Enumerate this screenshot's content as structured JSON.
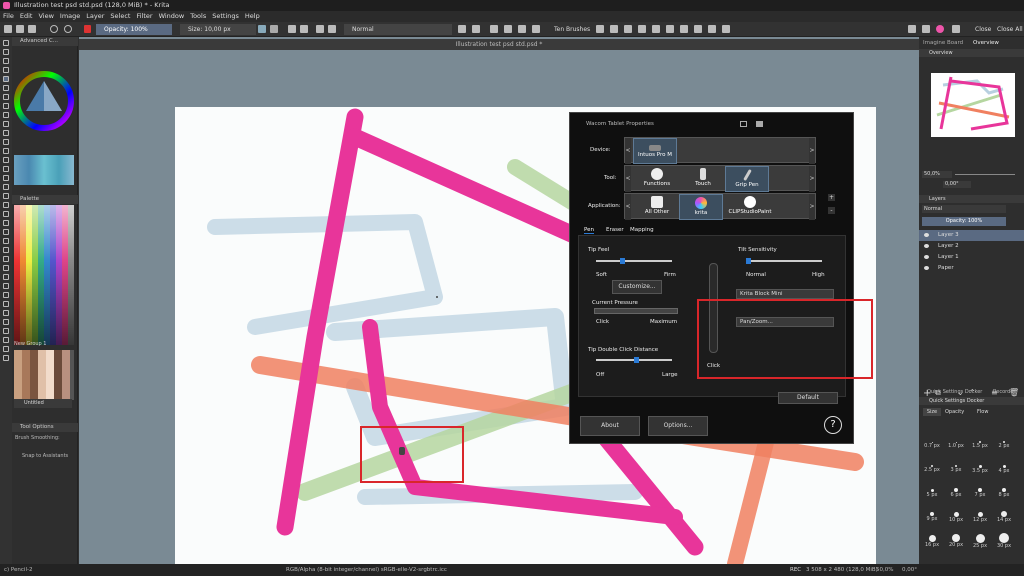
{
  "window": {
    "title": "Illustration test psd std.psd (128,0 MiB)  * - Krita"
  },
  "menu": [
    "File",
    "Edit",
    "View",
    "Image",
    "Layer",
    "Select",
    "Filter",
    "Window",
    "Tools",
    "Settings",
    "Help"
  ],
  "toolbar": {
    "opacity": "Opacity: 100%",
    "size": "Size: 10,00 px",
    "blend_mode": "Normal",
    "brushes_label": "Ten Brushes",
    "close_label": "Close",
    "close_all_label": "Close All"
  },
  "left_dock": {
    "advanced_color": "Advanced C...",
    "palette_title": "Palette",
    "palette_group": "New Group 1",
    "palette_name": "Untitled",
    "tool_options_title": "Tool Options",
    "brush_smoothing": "Brush Smoothing:",
    "snap_assistants": "Snap to Assistants"
  },
  "document": {
    "tab": "Illustration test psd std.psd *"
  },
  "right_dock": {
    "tabs": [
      "Imagine Board",
      "Overview"
    ],
    "overview_title": "Overview",
    "zoom": "50,0%",
    "rotation": "0,00°",
    "layers_title": "Layers",
    "blend": "Normal",
    "opacity": "Opacity:  100%",
    "layers": [
      "Layer 3",
      "Layer 2",
      "Layer 1",
      "Paper"
    ],
    "bottom_tabs": [
      "Quick Settings Docker",
      "Recorder"
    ],
    "qs_title": "Quick Settings Docker",
    "qs_tabs": [
      "Size",
      "Opacity",
      "Flow"
    ],
    "brush_sizes": [
      "0.7 px",
      "1.0 px",
      "1.5 px",
      "2 px",
      "2.5 px",
      "3 px",
      "3.5 px",
      "4 px",
      "5 px",
      "6 px",
      "7 px",
      "8 px",
      "9 px",
      "10 px",
      "12 px",
      "14 px",
      "16 px",
      "20 px",
      "25 px",
      "30 px"
    ]
  },
  "status": {
    "brush": "c) Pencil-2",
    "color_space": "RGB/Alpha (8-bit integer/channel)  sRGB-elle-V2-srgbtrc.icc",
    "rec": "REC",
    "dimensions": "3 508 x 2 480 (128,0 MiB)",
    "zoom": "50,0%",
    "rotation": "0,00°"
  },
  "wacom": {
    "title": "Wacom Tablet Properties",
    "device_label": "Device:",
    "device_tile": "Intuos Pro M",
    "tool_label": "Tool:",
    "tools": [
      "Functions",
      "Touch",
      "Grip Pen"
    ],
    "application_label": "Application:",
    "apps": [
      "All Other",
      "krita",
      "CLIPStudioPaint"
    ],
    "tabs": [
      "Pen",
      "Eraser",
      "Mapping"
    ],
    "tip_feel": "Tip Feel",
    "soft": "Soft",
    "firm": "Firm",
    "customize": "Customize...",
    "current_pressure": "Current Pressure",
    "click": "Click",
    "maximum": "Maximum",
    "tip_double_click": "Tip Double Click Distance",
    "off": "Off",
    "large": "Large",
    "tilt_sensitivity": "Tilt Sensitivity",
    "normal": "Normal",
    "high": "High",
    "upper_button": "Krita Block Mini",
    "lower_button": "Pan/Zoom...",
    "pen_click": "Click",
    "default": "Default",
    "about": "About",
    "options": "Options...",
    "help": "?"
  }
}
